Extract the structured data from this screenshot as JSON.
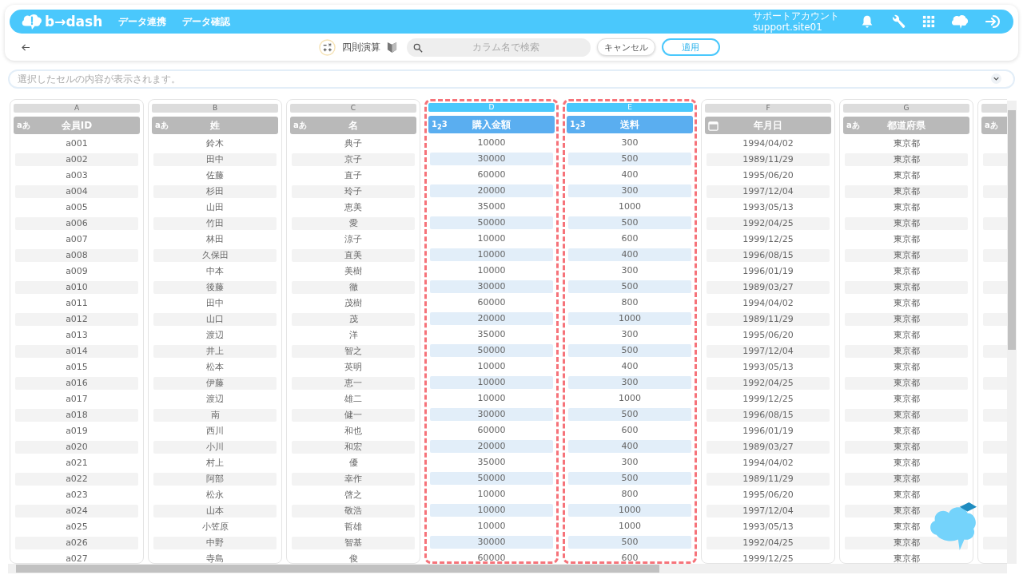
{
  "header": {
    "logo": "b→dash",
    "nav": [
      {
        "label": "データ連携"
      },
      {
        "label": "データ確認"
      }
    ],
    "account": {
      "name": "サポートアカウント",
      "id": "support.site01"
    }
  },
  "toolbar": {
    "title": "四則演算",
    "search": {
      "placeholder": "カラム名で検索"
    },
    "buttons": [
      {
        "label": "キャンセル",
        "kind": "secondary"
      },
      {
        "label": "適用",
        "kind": "primary"
      }
    ]
  },
  "cell_bar": {
    "placeholder": "選択したセルの内容が表示されます。"
  },
  "columns": [
    {
      "letter": "A",
      "name": "会員ID",
      "kind": "text",
      "type_label": "aあ",
      "selected": false,
      "cells": [
        "a001",
        "a002",
        "a003",
        "a004",
        "a005",
        "a006",
        "a007",
        "a008",
        "a009",
        "a010",
        "a011",
        "a012",
        "a013",
        "a014",
        "a015",
        "a016",
        "a017",
        "a018",
        "a019",
        "a020",
        "a021",
        "a022",
        "a023",
        "a024",
        "a025",
        "a026",
        "a027"
      ]
    },
    {
      "letter": "B",
      "name": "姓",
      "kind": "text",
      "type_label": "aあ",
      "selected": false,
      "cells": [
        "鈴木",
        "田中",
        "佐藤",
        "杉田",
        "山田",
        "竹田",
        "林田",
        "久保田",
        "中本",
        "後藤",
        "田中",
        "山口",
        "渡辺",
        "井上",
        "松本",
        "伊藤",
        "渡辺",
        "南",
        "西川",
        "小川",
        "村上",
        "阿部",
        "松永",
        "山本",
        "小笠原",
        "中野",
        "寺島"
      ]
    },
    {
      "letter": "C",
      "name": "名",
      "kind": "text",
      "type_label": "aあ",
      "selected": false,
      "cells": [
        "典子",
        "京子",
        "直子",
        "玲子",
        "恵美",
        "愛",
        "涼子",
        "直美",
        "美樹",
        "徹",
        "茂樹",
        "茂",
        "洋",
        "智之",
        "英明",
        "恵一",
        "雄二",
        "健一",
        "和也",
        "和宏",
        "優",
        "幸作",
        "啓之",
        "敬浩",
        "哲雄",
        "智基",
        "俊"
      ]
    },
    {
      "letter": "D",
      "name": "購入金額",
      "kind": "number",
      "type_label": "1$_{2}$3",
      "selected": true,
      "cells": [
        "10000",
        "30000",
        "60000",
        "20000",
        "35000",
        "50000",
        "10000",
        "10000",
        "10000",
        "30000",
        "60000",
        "20000",
        "35000",
        "50000",
        "10000",
        "10000",
        "10000",
        "30000",
        "60000",
        "20000",
        "35000",
        "50000",
        "10000",
        "10000",
        "10000",
        "30000",
        "60000"
      ]
    },
    {
      "letter": "E",
      "name": "送料",
      "kind": "number",
      "type_label": "1$_{2}$3",
      "selected": true,
      "cells": [
        "300",
        "500",
        "400",
        "300",
        "1000",
        "500",
        "600",
        "400",
        "300",
        "500",
        "800",
        "1000",
        "300",
        "500",
        "400",
        "300",
        "1000",
        "500",
        "600",
        "400",
        "300",
        "500",
        "800",
        "1000",
        "1000",
        "500",
        "600"
      ]
    },
    {
      "letter": "F",
      "name": "年月日",
      "kind": "date",
      "selected": false,
      "cells": [
        "1994/04/02",
        "1989/11/29",
        "1995/06/20",
        "1997/12/04",
        "1993/05/13",
        "1992/04/25",
        "1999/12/25",
        "1996/08/15",
        "1996/01/19",
        "1989/03/27",
        "1994/04/02",
        "1989/11/29",
        "1995/06/20",
        "1997/12/04",
        "1993/05/13",
        "1992/04/25",
        "1999/12/25",
        "1996/08/15",
        "1996/01/19",
        "1989/03/27",
        "1994/04/02",
        "1989/11/29",
        "1995/06/20",
        "1997/12/04",
        "1993/05/13",
        "1992/04/25",
        "1999/12/25"
      ]
    },
    {
      "letter": "G",
      "name": "都道府県",
      "kind": "text",
      "type_label": "aあ",
      "selected": false,
      "cells": [
        "東京都",
        "東京都",
        "東京都",
        "東京都",
        "東京都",
        "東京都",
        "東京都",
        "東京都",
        "東京都",
        "東京都",
        "東京都",
        "東京都",
        "東京都",
        "東京都",
        "東京都",
        "東京都",
        "東京都",
        "東京都",
        "東京都",
        "東京都",
        "東京都",
        "東京都",
        "東京都",
        "東京都",
        "東京都",
        "東京都",
        "東京都"
      ]
    },
    {
      "kind": "text",
      "type_label": "aあ",
      "selected": false
    }
  ]
}
